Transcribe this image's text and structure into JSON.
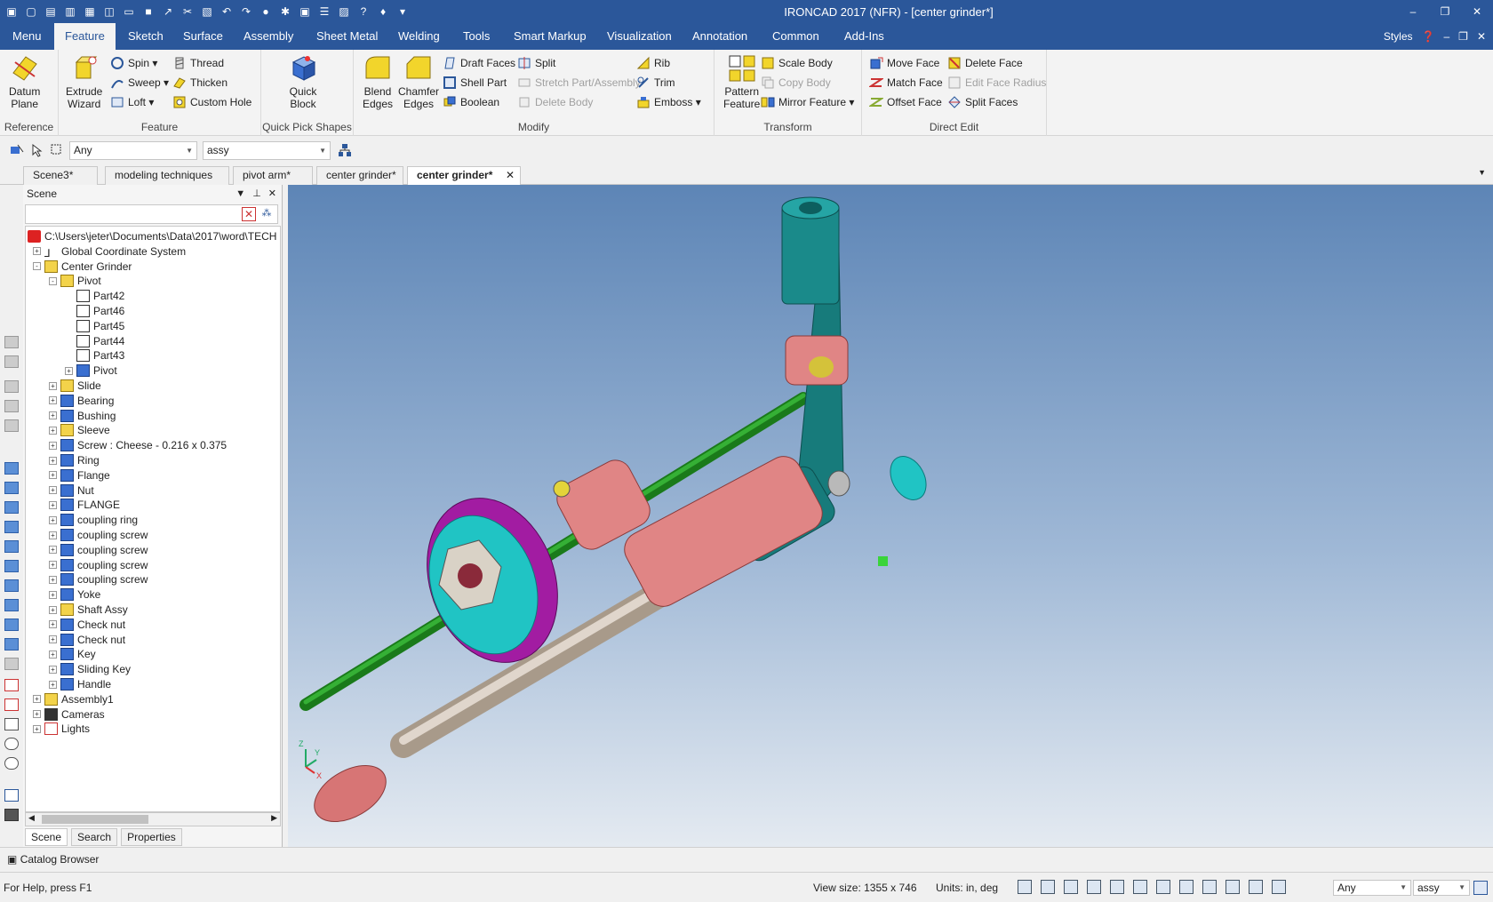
{
  "window": {
    "title": "IRONCAD 2017 (NFR) - [center grinder*]",
    "controls": [
      "–",
      "❐",
      "✕"
    ]
  },
  "ribbon_tabs": {
    "menu": "Menu",
    "items": [
      "Feature",
      "Sketch",
      "Surface",
      "Assembly",
      "Sheet Metal",
      "Welding",
      "Tools",
      "Smart Markup",
      "Visualization",
      "Annotation",
      "Common",
      "Add-Ins"
    ],
    "active": "Feature",
    "styles_label": "Styles"
  },
  "ribbon": {
    "reference": {
      "group": "Reference",
      "datum_plane_1": "Datum",
      "datum_plane_2": "Plane"
    },
    "feature": {
      "group": "Feature",
      "extrude_wizard_1": "Extrude",
      "extrude_wizard_2": "Wizard",
      "spin": "Spin",
      "sweep": "Sweep",
      "loft": "Loft",
      "thread": "Thread",
      "thicken": "Thicken",
      "custom_hole": "Custom Hole"
    },
    "quick_pick": {
      "group": "Quick Pick Shapes",
      "quick_block_1": "Quick",
      "quick_block_2": "Block"
    },
    "modify": {
      "group": "Modify",
      "blend_1": "Blend",
      "blend_2": "Edges",
      "chamfer_1": "Chamfer",
      "chamfer_2": "Edges",
      "draft_faces": "Draft Faces",
      "shell_part": "Shell Part",
      "boolean": "Boolean",
      "split": "Split",
      "stretch": "Stretch Part/Assembly",
      "delete_body": "Delete Body",
      "rib": "Rib",
      "trim": "Trim",
      "emboss": "Emboss"
    },
    "transform": {
      "group": "Transform",
      "pattern_1": "Pattern",
      "pattern_2": "Feature",
      "scale_body": "Scale Body",
      "copy_body": "Copy Body",
      "mirror_feature": "Mirror Feature"
    },
    "direct_edit": {
      "group": "Direct Edit",
      "move_face": "Move Face",
      "match_face": "Match Face",
      "offset_face": "Offset Face",
      "delete_face": "Delete Face",
      "edit_face_radius": "Edit Face Radius",
      "split_faces": "Split Faces"
    }
  },
  "selection_bar": {
    "filter": "Any",
    "scope": "assy"
  },
  "doc_tabs": [
    "Scene3*",
    "modeling techniques",
    "pivot arm*",
    "center grinder*",
    "center grinder*"
  ],
  "scene": {
    "title": "Scene",
    "tree": [
      {
        "label": "C:\\Users\\jeter\\Documents\\Data\\2017\\word\\TECH",
        "icon": "root-icon"
      },
      {
        "label": "Global Coordinate System",
        "icon": "coordinate-system-icon"
      },
      {
        "label": "Center Grinder",
        "icon": "assembly-icon"
      },
      {
        "label": "Pivot",
        "icon": "assembly-icon"
      },
      {
        "label": "Part42",
        "icon": "sketch-part-icon"
      },
      {
        "label": "Part46",
        "icon": "sketch-part-icon"
      },
      {
        "label": "Part45",
        "icon": "sketch-part-icon"
      },
      {
        "label": "Part44",
        "icon": "sketch-part-icon"
      },
      {
        "label": "Part43",
        "icon": "sketch-part-icon"
      },
      {
        "label": "Pivot",
        "icon": "part-icon"
      },
      {
        "label": "Slide",
        "icon": "assembly-icon"
      },
      {
        "label": "Bearing",
        "icon": "part-icon"
      },
      {
        "label": "Bushing",
        "icon": "part-icon"
      },
      {
        "label": "Sleeve",
        "icon": "assembly-icon"
      },
      {
        "label": "Screw : Cheese - 0.216 x 0.375",
        "icon": "part-icon"
      },
      {
        "label": "Ring",
        "icon": "part-icon"
      },
      {
        "label": "Flange",
        "icon": "part-icon"
      },
      {
        "label": "Nut",
        "icon": "part-icon"
      },
      {
        "label": "FLANGE",
        "icon": "part-icon"
      },
      {
        "label": "coupling ring",
        "icon": "part-icon"
      },
      {
        "label": "coupling screw",
        "icon": "part-icon"
      },
      {
        "label": "coupling screw",
        "icon": "part-icon"
      },
      {
        "label": "coupling screw",
        "icon": "part-icon"
      },
      {
        "label": "coupling screw",
        "icon": "part-icon"
      },
      {
        "label": "Yoke",
        "icon": "part-icon"
      },
      {
        "label": "Shaft Assy",
        "icon": "assembly-icon"
      },
      {
        "label": "Check nut",
        "icon": "part-icon"
      },
      {
        "label": "Check nut",
        "icon": "part-icon"
      },
      {
        "label": "Key",
        "icon": "part-icon"
      },
      {
        "label": "Sliding Key",
        "icon": "part-icon"
      },
      {
        "label": "Handle",
        "icon": "part-icon"
      },
      {
        "label": "Assembly1",
        "icon": "assembly-icon"
      },
      {
        "label": "Cameras",
        "icon": "camera-icon"
      },
      {
        "label": "Lights",
        "icon": "light-icon"
      }
    ],
    "bottom_tabs": [
      "Scene",
      "Search",
      "Properties"
    ]
  },
  "axis": {
    "z": "Z",
    "y": "Y",
    "x": "X"
  },
  "catalog_browser": "Catalog Browser",
  "status": {
    "help": "For Help, press F1",
    "view_size": "View size: 1355 x  746",
    "units": "Units: in, deg",
    "filter": "Any",
    "scope": "assy"
  },
  "colors": {
    "title_blue": "#2b579a",
    "viewport_top": "#5d85b6",
    "viewport_bottom": "#e4eaf1"
  }
}
